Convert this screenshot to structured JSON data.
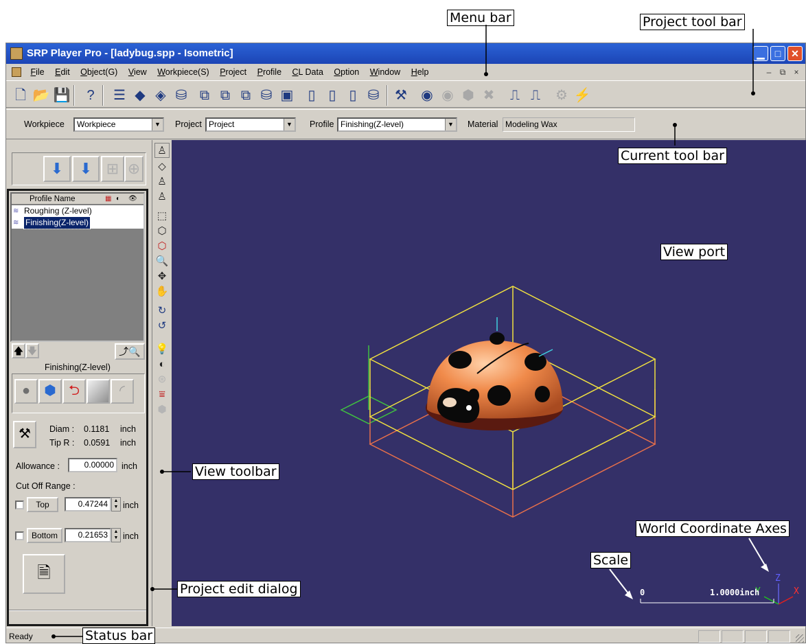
{
  "annotations": {
    "menu_bar": "Menu bar",
    "project_tool_bar": "Project tool bar",
    "current_tool_bar": "Current tool bar",
    "view_port": "View port",
    "view_toolbar": "View toolbar",
    "world_axes": "World Coordinate Axes",
    "scale": "Scale",
    "project_edit_dialog": "Project edit dialog",
    "status_bar": "Status bar"
  },
  "window": {
    "title": "SRP Player Pro - [ladybug.spp - Isometric]"
  },
  "menu": [
    "File",
    "Edit",
    "Object(G)",
    "View",
    "Workpiece(S)",
    "Project",
    "Profile",
    "CL Data",
    "Option",
    "Window",
    "Help"
  ],
  "current_bar": {
    "workpiece_label": "Workpiece",
    "workpiece_value": "Workpiece",
    "project_label": "Project",
    "project_value": "Project",
    "profile_label": "Profile",
    "profile_value": "Finishing(Z-level)",
    "material_label": "Material",
    "material_value": "Modeling Wax"
  },
  "profiles": {
    "header": "Profile Name",
    "rows": [
      "Roughing (Z-level)",
      "Finishing(Z-level)"
    ],
    "selected_index": 1
  },
  "dialog": {
    "current_profile": "Finishing(Z-level)",
    "diam_label": "Diam :",
    "diam_value": "0.1181",
    "diam_unit": "inch",
    "tipr_label": "Tip R :",
    "tipr_value": "0.0591",
    "tipr_unit": "inch",
    "allowance_label": "Allowance :",
    "allowance_value": "0.00000",
    "allowance_unit": "inch",
    "cutoff_label": "Cut Off Range :",
    "top_label": "Top",
    "top_value": "0.47244",
    "top_unit": "inch",
    "bottom_label": "Bottom",
    "bottom_value": "0.21653",
    "bottom_unit": "inch"
  },
  "viewport": {
    "background": "#343068",
    "scale_zero": "0",
    "scale_value": "1.0000inch",
    "axis_x": "X",
    "axis_y": "Y",
    "axis_z": "Z"
  },
  "status": {
    "text": "Ready"
  }
}
